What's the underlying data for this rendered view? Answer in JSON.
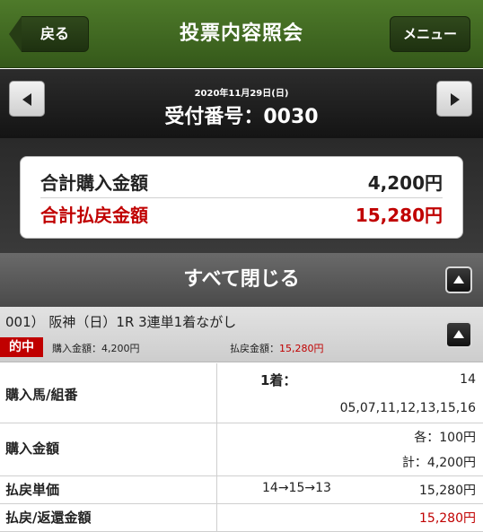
{
  "header": {
    "back_label": "戻る",
    "title": "投票内容照会",
    "menu_label": "メニュー"
  },
  "receipt": {
    "date": "2020年11月29日(日)",
    "number_label": "受付番号：0030"
  },
  "summary": {
    "total_purchase_label": "合計購入金額",
    "total_purchase_value": "4,200円",
    "total_payout_label": "合計払戻金額",
    "total_payout_value": "15,280円"
  },
  "close_all_label": "すべて閉じる",
  "bet": {
    "title": "001） 阪神（日）1R 3連単1着ながし",
    "hit_badge": "的中",
    "purchase_label": "購入金額：",
    "purchase_value": "4,200円",
    "payout_label": "払戻金額：",
    "payout_value": "15,280円"
  },
  "details": {
    "horses_label": "購入馬/組番",
    "first_label": "1着：",
    "first_value": "14",
    "others_value": "05,07,11,12,13,15,16",
    "amount_label": "購入金額",
    "each_value": "各：100円",
    "total_value": "計：4,200円",
    "unit_label": "払戻単価",
    "unit_combo": "14→15→13",
    "unit_value": "15,280円",
    "refund_label": "払戻/返還金額",
    "refund_value": "15,280円"
  },
  "colors": {
    "header_green": "#3f6822",
    "accent_red": "#c00000"
  }
}
